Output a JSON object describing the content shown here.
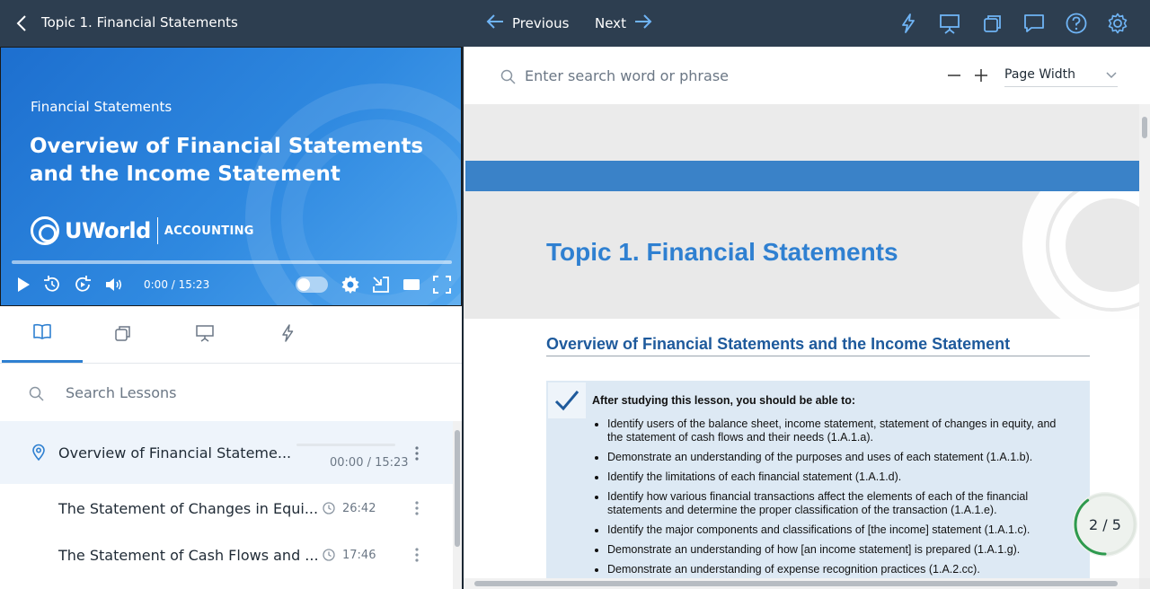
{
  "topbar": {
    "title": "Topic 1. Financial Statements",
    "previous_label": "Previous",
    "next_label": "Next",
    "icons": [
      "flash-icon",
      "presentation-icon",
      "flashcards-icon",
      "comment-icon",
      "help-icon",
      "gear-icon"
    ]
  },
  "video": {
    "kicker": "Financial Statements",
    "title": "Overview of Financial Statements and the Income Statement",
    "brand_name": "UWorld",
    "brand_sub": "ACCOUNTING",
    "time": "0:00 / 15:23"
  },
  "left_tabs": [
    "book-icon",
    "flashcards-icon",
    "presentation-icon",
    "flash-icon"
  ],
  "lessons_search": {
    "placeholder": "Search Lessons"
  },
  "lessons": [
    {
      "name": "Overview of Financial Stateme...",
      "duration": "00:00 / 15:23",
      "current": true
    },
    {
      "name": "The Statement of Changes in Equi...",
      "duration": "26:42",
      "current": false
    },
    {
      "name": "The Statement of Cash Flows and ...",
      "duration": "17:46",
      "current": false
    }
  ],
  "doc_search": {
    "placeholder": "Enter search word or phrase"
  },
  "zoom": {
    "value": "Page Width"
  },
  "document": {
    "heading": "Topic 1. Financial Statements",
    "subheading": "Overview of Financial Statements and the Income Statement",
    "objectives_lead": "After studying this lesson, you should be able to:",
    "objectives": [
      "Identify users of the balance sheet, income statement, statement of changes in equity, and the statement of cash flows and their needs (1.A.1.a).",
      "Demonstrate an understanding of the purposes and uses of each statement (1.A.1.b).",
      "Identify the limitations of each financial statement (1.A.1.d).",
      "Identify how various financial transactions affect the elements of each of the financial statements and determine the proper classification of the transaction (1.A.1.e).",
      "Identify the major components and classifications of [the income] statement (1.A.1.c).",
      "Demonstrate an understanding of how [an income statement] is prepared (1.A.1.g).",
      "Demonstrate an understanding of expense recognition practices (1.A.2.cc)."
    ]
  },
  "pager": {
    "text": "2 / 5",
    "progress": 0.4
  },
  "colors": {
    "topbar": "#2d3e50",
    "accent": "#2f80d1",
    "heading": "#2f80d1",
    "subheading": "#1e5a9c"
  }
}
